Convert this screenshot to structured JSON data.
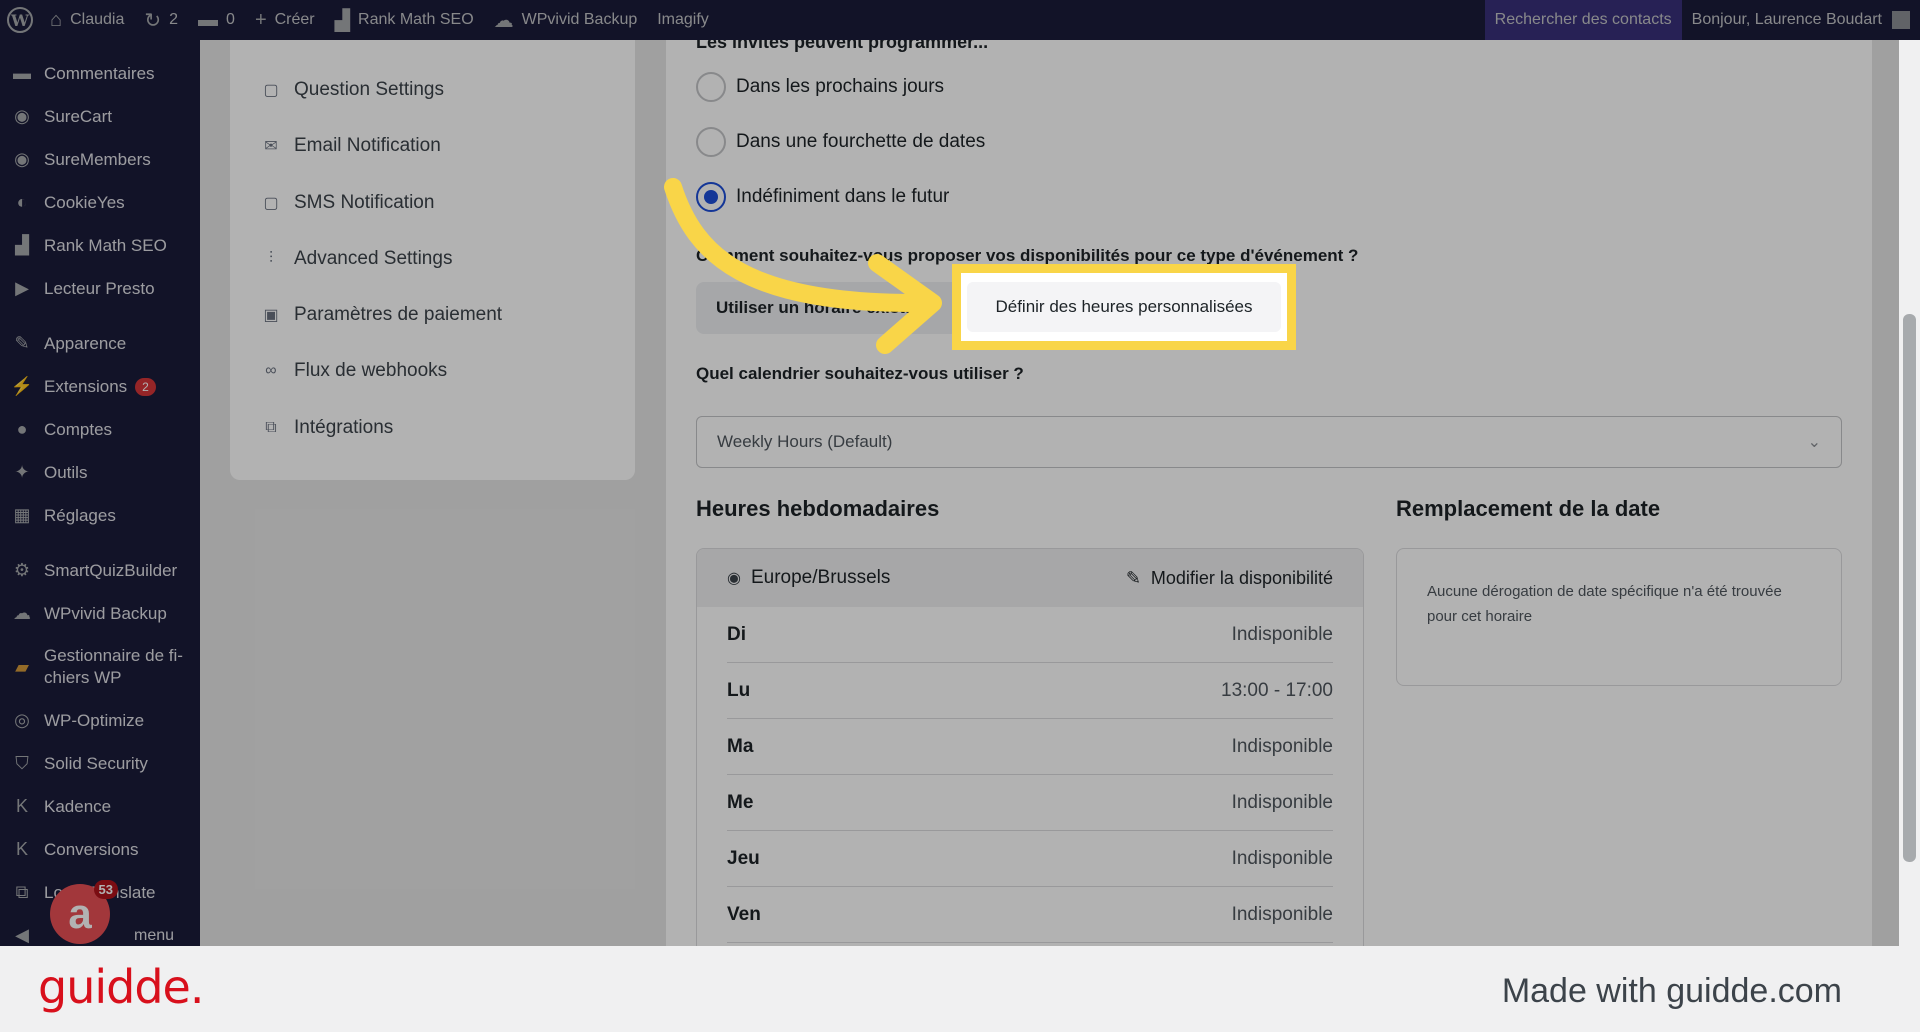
{
  "adminbar": {
    "site_name": "Claudia",
    "updates_count": "2",
    "comments_count": "0",
    "new_label": "Créer",
    "rankmath": "Rank Math SEO",
    "wpvivid": "WPvivid Backup",
    "imagify": "Imagify",
    "search_contacts": "Rechercher des contacts",
    "greeting": "Bonjour, Laurence Boudart"
  },
  "sidebar": {
    "items": [
      {
        "label": "Commentaires",
        "icon": "comment-icon"
      },
      {
        "label": "SureCart",
        "icon": "surecart-icon"
      },
      {
        "label": "SureMembers",
        "icon": "suremembers-icon"
      },
      {
        "label": "CookieYes",
        "icon": "cookie-icon"
      },
      {
        "label": "Rank Math SEO",
        "icon": "rankmath-icon"
      },
      {
        "label": "Lecteur Presto",
        "icon": "presto-icon"
      },
      {
        "label": "Apparence",
        "icon": "brush-icon"
      },
      {
        "label": "Extensions",
        "icon": "plugin-icon",
        "badge": "2"
      },
      {
        "label": "Comptes",
        "icon": "user-icon"
      },
      {
        "label": "Outils",
        "icon": "wrench-icon"
      },
      {
        "label": "Réglages",
        "icon": "settings-icon"
      },
      {
        "label": "SmartQuizBuilder",
        "icon": "gear-icon"
      },
      {
        "label": "WPvivid Backup",
        "icon": "cloud-icon"
      },
      {
        "label": "Gestionnaire de fi-chiers WP",
        "icon": "folder-icon"
      },
      {
        "label": "WP-Optimize",
        "icon": "optimize-icon"
      },
      {
        "label": "Solid Security",
        "icon": "shield-icon"
      },
      {
        "label": "Kadence",
        "icon": "kadence-icon"
      },
      {
        "label": "Conversions",
        "icon": "conversions-icon"
      },
      {
        "label": "Loco Translate",
        "icon": "translate-icon"
      }
    ],
    "collapse_label": "menu",
    "assistant_count": "53"
  },
  "settings_menu": {
    "items": [
      {
        "label": "Question Settings",
        "icon": "question-icon"
      },
      {
        "label": "Email Notification",
        "icon": "email-icon"
      },
      {
        "label": "SMS Notification",
        "icon": "sms-icon"
      },
      {
        "label": "Advanced Settings",
        "icon": "sliders-icon"
      },
      {
        "label": "Paramètres de paiement",
        "icon": "payment-icon"
      },
      {
        "label": "Flux de webhooks",
        "icon": "link-icon"
      },
      {
        "label": "Intégrations",
        "icon": "integrations-icon"
      }
    ]
  },
  "main": {
    "schedule_question": "Les invités peuvent programmer...",
    "radio_options": [
      {
        "label": "Dans les prochains jours",
        "checked": false
      },
      {
        "label": "Dans une fourchette de dates",
        "checked": false
      },
      {
        "label": "Indéfiniment dans le futur",
        "checked": true
      }
    ],
    "availability_question": "Comment souhaitez-vous proposer vos disponibilités pour ce type d'événement ?",
    "option_existing": "Utiliser un horaire existant",
    "option_custom": "Définir des heures personnalisées",
    "calendar_question": "Quel calendrier souhaitez-vous utiliser ?",
    "calendar_selected": "Weekly Hours (Default)",
    "weekly_title": "Heures hebdomadaires",
    "timezone": "Europe/Brussels",
    "edit_availability": "Modifier la disponibilité",
    "days": [
      {
        "day": "Di",
        "value": "Indisponible"
      },
      {
        "day": "Lu",
        "value": "13:00 - 17:00"
      },
      {
        "day": "Ma",
        "value": "Indisponible"
      },
      {
        "day": "Me",
        "value": "Indisponible"
      },
      {
        "day": "Jeu",
        "value": "Indisponible"
      },
      {
        "day": "Ven",
        "value": "Indisponible"
      }
    ],
    "override_title": "Remplacement de la date",
    "override_empty": "Aucune dérogation de date spécifique n'a été trouvée pour cet horaire"
  },
  "footer": {
    "logo": "guidde.",
    "made_with": "Made with guidde.com"
  },
  "colors": {
    "admin_bg": "#1b1c3a",
    "highlight": "#f9d548",
    "brand_red": "#d8101c",
    "radio_checked": "#1d4ed8"
  }
}
